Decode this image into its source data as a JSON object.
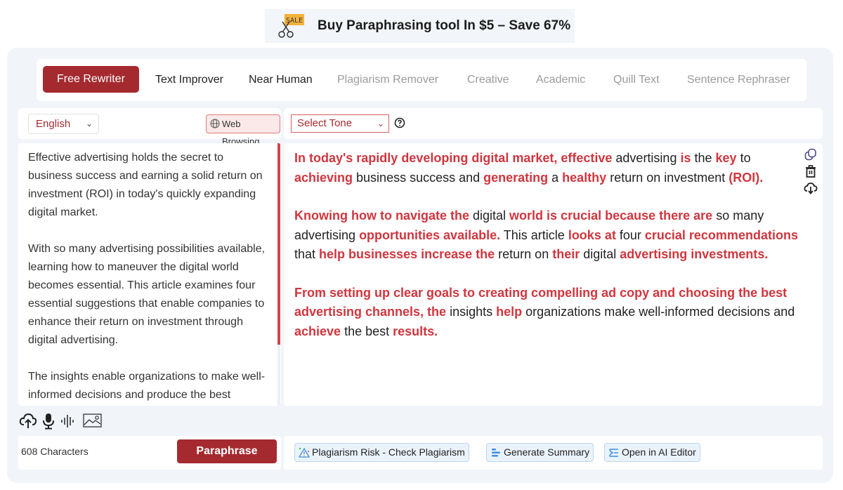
{
  "promo": {
    "icon": "sale-tag-icon",
    "icon_text": "SALE",
    "text": "Buy Paraphrasing tool In $5 – Save 67%"
  },
  "modes": [
    {
      "label": "Free Rewriter",
      "state": "active"
    },
    {
      "label": "Text Improver",
      "state": "enabled"
    },
    {
      "label": "Near Human",
      "state": "enabled"
    },
    {
      "label": "Plagiarism Remover",
      "state": "disabled"
    },
    {
      "label": "Creative",
      "state": "disabled"
    },
    {
      "label": "Academic",
      "state": "disabled"
    },
    {
      "label": "Quill Text",
      "state": "disabled"
    },
    {
      "label": "Sentence Rephraser",
      "state": "disabled"
    }
  ],
  "input": {
    "language": "English",
    "web_browsing_label": "Web Browsing",
    "paragraphs": [
      "Effective advertising holds the secret to business success and earning a solid return on investment (ROI) in today's quickly expanding digital market.",
      "With so many advertising possibilities available, learning how to maneuver the digital world becomes essential. This article examines four essential suggestions that enable companies to enhance their return on investment through digital advertising.",
      "The insights enable organizations to make well-informed decisions and produce the best"
    ],
    "char_count": "608 Characters",
    "paraphrase_label": "Paraphrase",
    "tools": [
      "upload-cloud-icon",
      "microphone-icon",
      "audio-wave-icon",
      "image-icon"
    ]
  },
  "output": {
    "tone_placeholder": "Select Tone",
    "paragraphs": [
      [
        {
          "t": "In today's rapidly developing digital market, effective",
          "c": true
        },
        {
          "t": " advertising ",
          "c": false
        },
        {
          "t": "is",
          "c": true
        },
        {
          "t": " the ",
          "c": false
        },
        {
          "t": "key",
          "c": true
        },
        {
          "t": " to ",
          "c": false
        },
        {
          "t": "achieving",
          "c": true
        },
        {
          "t": " business success and ",
          "c": false
        },
        {
          "t": "generating",
          "c": true
        },
        {
          "t": " a ",
          "c": false
        },
        {
          "t": "healthy",
          "c": true
        },
        {
          "t": " return on investment ",
          "c": false
        },
        {
          "t": "(ROI).",
          "c": true
        }
      ],
      [
        {
          "t": "Knowing how to navigate the",
          "c": true
        },
        {
          "t": " digital ",
          "c": false
        },
        {
          "t": "world is crucial because there are",
          "c": true
        },
        {
          "t": " so many advertising ",
          "c": false
        },
        {
          "t": "opportunities available.",
          "c": true
        },
        {
          "t": " This article ",
          "c": false
        },
        {
          "t": "looks at",
          "c": true
        },
        {
          "t": " four ",
          "c": false
        },
        {
          "t": "crucial recommendations",
          "c": true
        },
        {
          "t": " that ",
          "c": false
        },
        {
          "t": "help businesses increase the",
          "c": true
        },
        {
          "t": " return on ",
          "c": false
        },
        {
          "t": "their",
          "c": true
        },
        {
          "t": " digital ",
          "c": false
        },
        {
          "t": "advertising investments.",
          "c": true
        }
      ],
      [
        {
          "t": "From setting up clear goals to creating compelling ad copy and choosing the best advertising channels, the",
          "c": true
        },
        {
          "t": " insights ",
          "c": false
        },
        {
          "t": "help",
          "c": true
        },
        {
          "t": " organizations make well-informed decisions and ",
          "c": false
        },
        {
          "t": "achieve",
          "c": true
        },
        {
          "t": " the best ",
          "c": false
        },
        {
          "t": "results.",
          "c": true
        }
      ]
    ],
    "side_icons": [
      "copy-icon",
      "trash-icon",
      "download-cloud-icon"
    ],
    "actions": [
      {
        "label": "Plagiarism Risk - Check Plagiarism",
        "icon": "plagiarism-warning-icon"
      },
      {
        "label": "Generate Summary",
        "icon": "summary-lines-icon"
      },
      {
        "label": "Open in AI Editor",
        "icon": "ai-editor-icon"
      }
    ]
  },
  "colors": {
    "accent": "#a52a2f",
    "changed_text": "#d0363e",
    "panel_bg": "#f1f5f9",
    "action_btn_bg": "#eaf3fb"
  }
}
